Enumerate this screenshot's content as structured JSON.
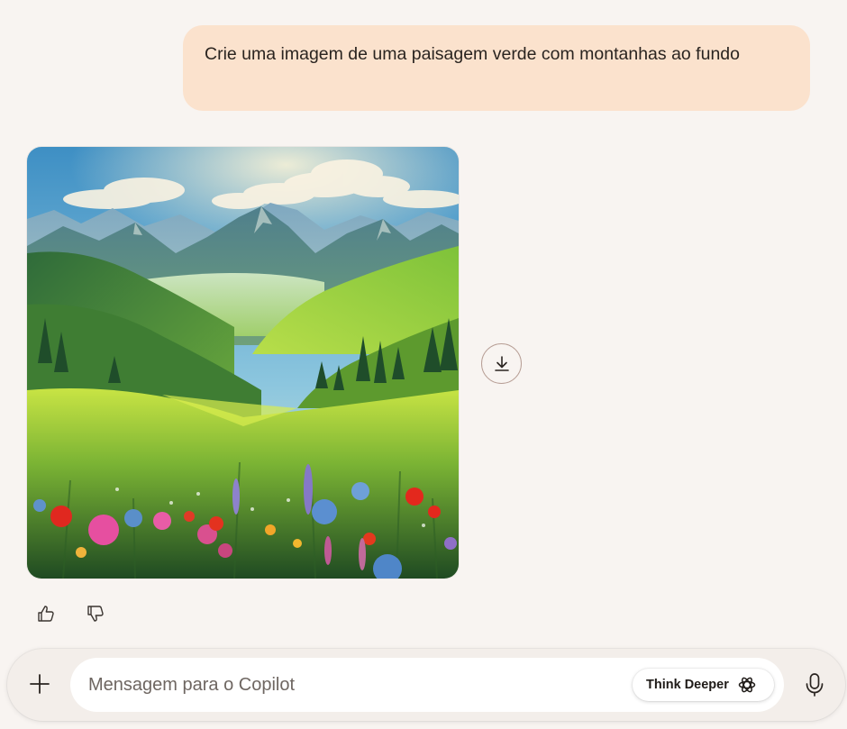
{
  "conversation": {
    "user_message": "Crie uma imagem de uma paisagem verde com montanhas ao fundo",
    "generated_image": {
      "alt": "Paisagem verde com montanhas ao fundo e flores silvestres"
    },
    "actions": {
      "download_icon": "download-icon",
      "like_icon": "thumbs-up-icon",
      "dislike_icon": "thumbs-down-icon"
    }
  },
  "composer": {
    "placeholder": "Mensagem para o Copilot",
    "value": "",
    "think_deeper_label": "Think Deeper",
    "add_icon": "plus-icon",
    "mic_icon": "microphone-icon"
  },
  "colors": {
    "background": "#f8f4f1",
    "user_bubble": "#fbe2cd",
    "composer_bg": "#f3eeea"
  }
}
